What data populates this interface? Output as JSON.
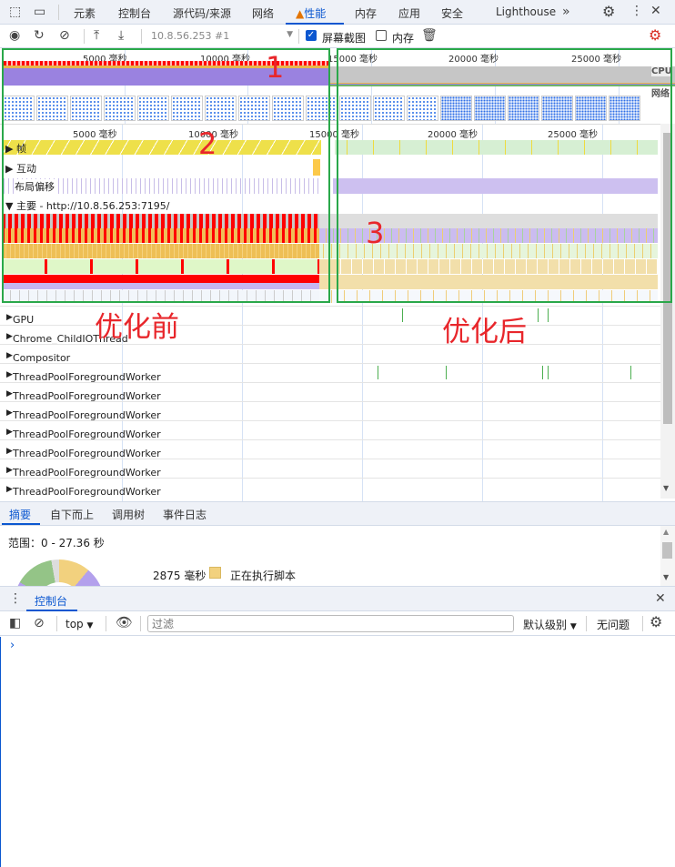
{
  "devtools_tabs": {
    "elements": "元素",
    "console": "控制台",
    "sources": "源代码/来源",
    "network": "网络",
    "performance": "性能",
    "memory": "内存",
    "application": "应用",
    "security": "安全",
    "lighthouse": "Lighthouse"
  },
  "toolbar": {
    "recording_select": "10.8.56.253 #1",
    "screenshots_label": "屏幕截图",
    "screenshots_checked": true,
    "memory_label": "内存",
    "memory_checked": false
  },
  "overview": {
    "ticks": [
      "5000 毫秒",
      "10000 毫秒",
      "15000 毫秒",
      "20000 毫秒",
      "25000 毫秒"
    ],
    "cpu_label": "CPU",
    "network_label": "网络"
  },
  "timeline": {
    "ticks": [
      "5000 毫秒",
      "10000 毫秒",
      "15000 毫秒",
      "20000 毫秒",
      "25000 毫秒"
    ],
    "tracks": {
      "frames": "帧",
      "interactions": "互动",
      "layout_shifts": "布局偏移",
      "main": "主要 - http://10.8.56.253:7195/"
    },
    "threads": [
      "GPU",
      "Chrome_ChildIOThread",
      "Compositor",
      "ThreadPoolForegroundWorker",
      "ThreadPoolForegroundWorker",
      "ThreadPoolForegroundWorker",
      "ThreadPoolForegroundWorker",
      "ThreadPoolForegroundWorker",
      "ThreadPoolForegroundWorker",
      "ThreadPoolForegroundWorker"
    ]
  },
  "annotations": {
    "one": "1",
    "two": "2",
    "three": "3",
    "before": "优化前",
    "after": "优化后"
  },
  "bottom_tabs": {
    "summary": "摘要",
    "bottom_up": "自下而上",
    "call_tree": "调用树",
    "event_log": "事件日志"
  },
  "summary": {
    "range": "范围：0 - 27.36 秒",
    "scripting_time": "2875 毫秒",
    "scripting_label": "正在执行脚本",
    "scripting_color": "#f2d17e"
  },
  "drawer": {
    "tab": "控制台",
    "context": "top",
    "filter_placeholder": "过滤",
    "level": "默认级别",
    "issues": "无问题",
    "prompt": "›"
  }
}
